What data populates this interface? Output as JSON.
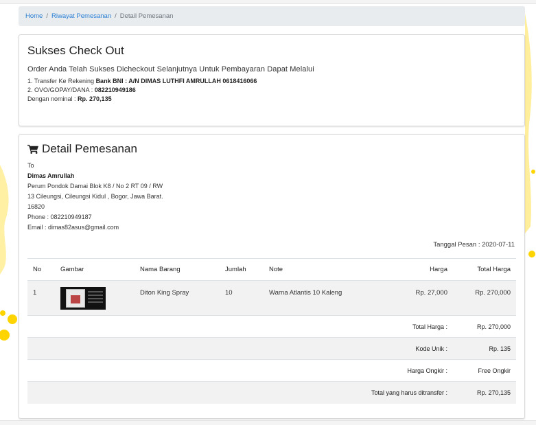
{
  "breadcrumb": {
    "home": "Home",
    "riwayat": "Riwayat Pemesanan",
    "separator": "/",
    "current": "Detail Pemesanan"
  },
  "checkout": {
    "title": "Sukses Check Out",
    "lead": "Order Anda Telah Sukses Dicheckout Selanjutnya Untuk Pembayaran Dapat Melalui",
    "line1_label": "1. Transfer Ke Rekening ",
    "line1_value": "Bank BNI : A/N DIMAS LUTHFI AMRULLAH 0618416066",
    "line2_label": "2. OVO/GOPAY/DANA : ",
    "line2_value": "082210949186",
    "line3_label": "Dengan nominal : ",
    "line3_value": "Rp. 270,135"
  },
  "detail": {
    "title": "Detail Pemesanan",
    "cart_icon": "shopping-cart-icon",
    "to_label": "To",
    "name": "Dimas Amrullah",
    "address1": "Perum Pondok Damai Blok K8 / No 2 RT 09 / RW",
    "address2": "13 Cileungsi, Cileungsi Kidul , Bogor, Jawa Barat.",
    "postal": "16820",
    "phone": "Phone : 082210949187",
    "email": "Email : dimas82asus@gmail.com",
    "tanggal": "Tanggal Pesan : 2020-07-11"
  },
  "table": {
    "headers": {
      "no": "No",
      "gambar": "Gambar",
      "nama": "Nama Barang",
      "jumlah": "Jumlah",
      "note": "Note",
      "harga": "Harga",
      "total": "Total Harga"
    },
    "rows": [
      {
        "no": "1",
        "nama": "Diton King Spray",
        "jumlah": "10",
        "note": "Warna Atlantis 10 Kaleng",
        "harga": "Rp. 27,000",
        "total": "Rp. 270,000"
      }
    ],
    "summary": {
      "total_label": "Total Harga :",
      "total_value": "Rp. 270,000",
      "kode_label": "Kode Unik :",
      "kode_value": "Rp. 135",
      "ongkir_label": "Harga Ongkir :",
      "ongkir_value": "Free Ongkir",
      "transfer_label": "Total yang harus ditransfer :",
      "transfer_value": "Rp. 270,135"
    }
  },
  "colors": {
    "link": "#2a7fd4",
    "splash": "#ffd400"
  }
}
